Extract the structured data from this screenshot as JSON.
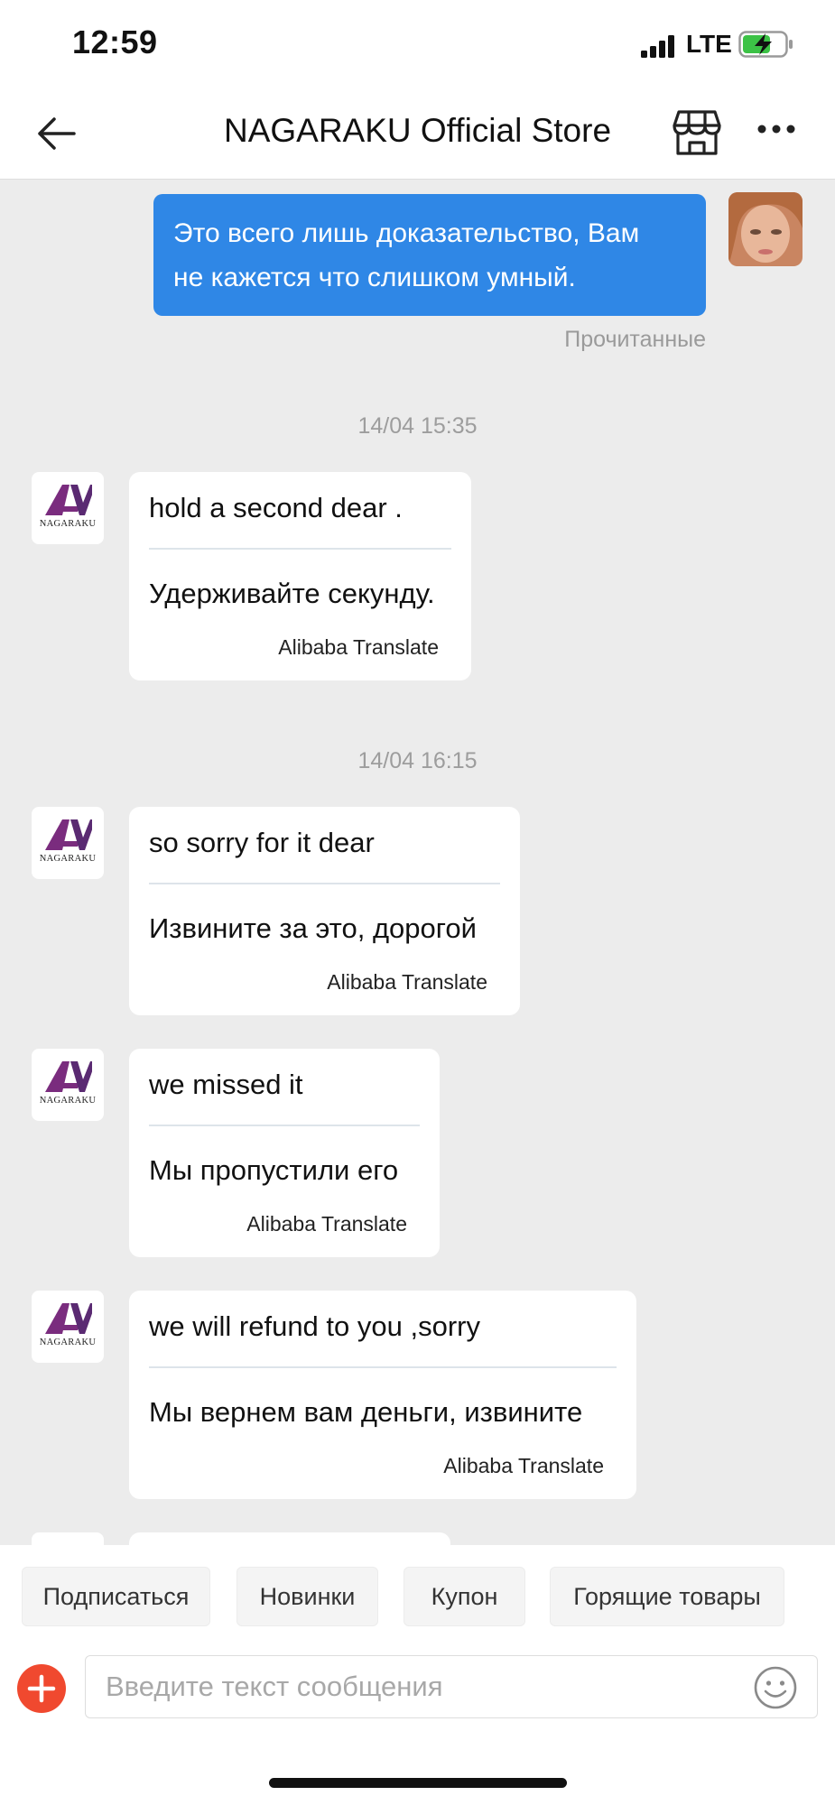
{
  "status_bar": {
    "time": "12:59",
    "carrier": "LTE"
  },
  "header": {
    "title": "NAGARAKU Official Store"
  },
  "outgoing": {
    "line1": "Это всего лишь доказательство, Вам",
    "line2": "не кажется что слишком умный.",
    "read_status": "Прочитанные"
  },
  "timestamps": [
    "14/04 15:35",
    "14/04 16:15"
  ],
  "store_logo_text": "NAGARAKU",
  "messages": [
    {
      "en": "hold  a second dear .",
      "ru": "Удерживайте секунду.",
      "translator": "Alibaba Translate"
    },
    {
      "en": "so sorry for it dear",
      "ru": "Извините за это, дорогой",
      "translator": "Alibaba Translate"
    },
    {
      "en": "we missed it",
      "ru": "Мы пропустили его",
      "translator": "Alibaba Translate"
    },
    {
      "en": "we will refund to you ,sorry",
      "ru": "Мы вернем вам деньги, извините",
      "translator": "Alibaba Translate"
    }
  ],
  "quick_actions": [
    "Подписаться",
    "Новинки",
    "Купон",
    "Горящие товары"
  ],
  "composer": {
    "placeholder": "Введите текст сообщения"
  },
  "colors": {
    "accent_blue": "#2f87e6",
    "add_button": "#f0492f",
    "logo_purple": "#7a2c7e"
  }
}
